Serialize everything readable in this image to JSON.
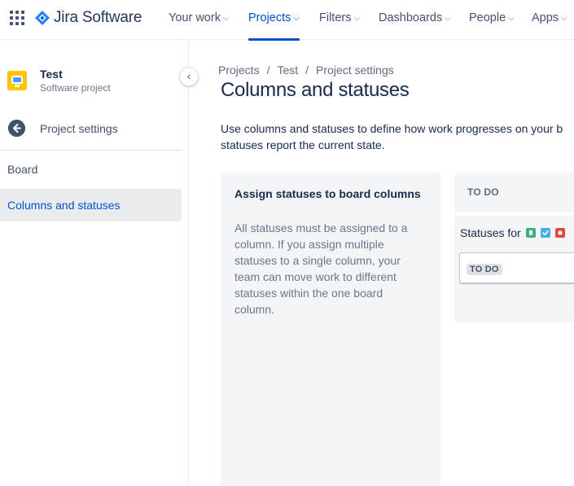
{
  "app": {
    "product_name": "Jira Software",
    "brand_color": "#0052cc",
    "logo_icon": "jira-diamond-icon"
  },
  "nav": {
    "items": [
      {
        "label": "Your work",
        "active": false
      },
      {
        "label": "Projects",
        "active": true
      },
      {
        "label": "Filters",
        "active": false
      },
      {
        "label": "Dashboards",
        "active": false
      },
      {
        "label": "People",
        "active": false
      },
      {
        "label": "Apps",
        "active": false
      }
    ]
  },
  "sidebar": {
    "project_name": "Test",
    "project_type": "Software project",
    "back_label": "Project settings",
    "section_label": "Board",
    "selected_item": "Columns and statuses",
    "collapse_icon": "chevron-left-icon"
  },
  "breadcrumb": [
    "Projects",
    "Test",
    "Project settings"
  ],
  "page": {
    "title": "Columns and statuses",
    "description_line1": "Use columns and statuses to define how work progresses on your b",
    "description_line2": "statuses report the current state."
  },
  "info_panel": {
    "title": "Assign statuses to board columns",
    "body": "All statuses must be assigned to a column. If you assign multiple statuses to a single column, your team can move work to different statuses within the one board column."
  },
  "column": {
    "header": "TO DO",
    "statuses_for_label": "Statuses for",
    "issue_type_icons": [
      {
        "name": "story-icon",
        "color": "#36b37e"
      },
      {
        "name": "task-icon",
        "color": "#4bade8"
      },
      {
        "name": "bug-icon",
        "color": "#e5493a"
      }
    ],
    "status_lozenge": "TO DO"
  }
}
